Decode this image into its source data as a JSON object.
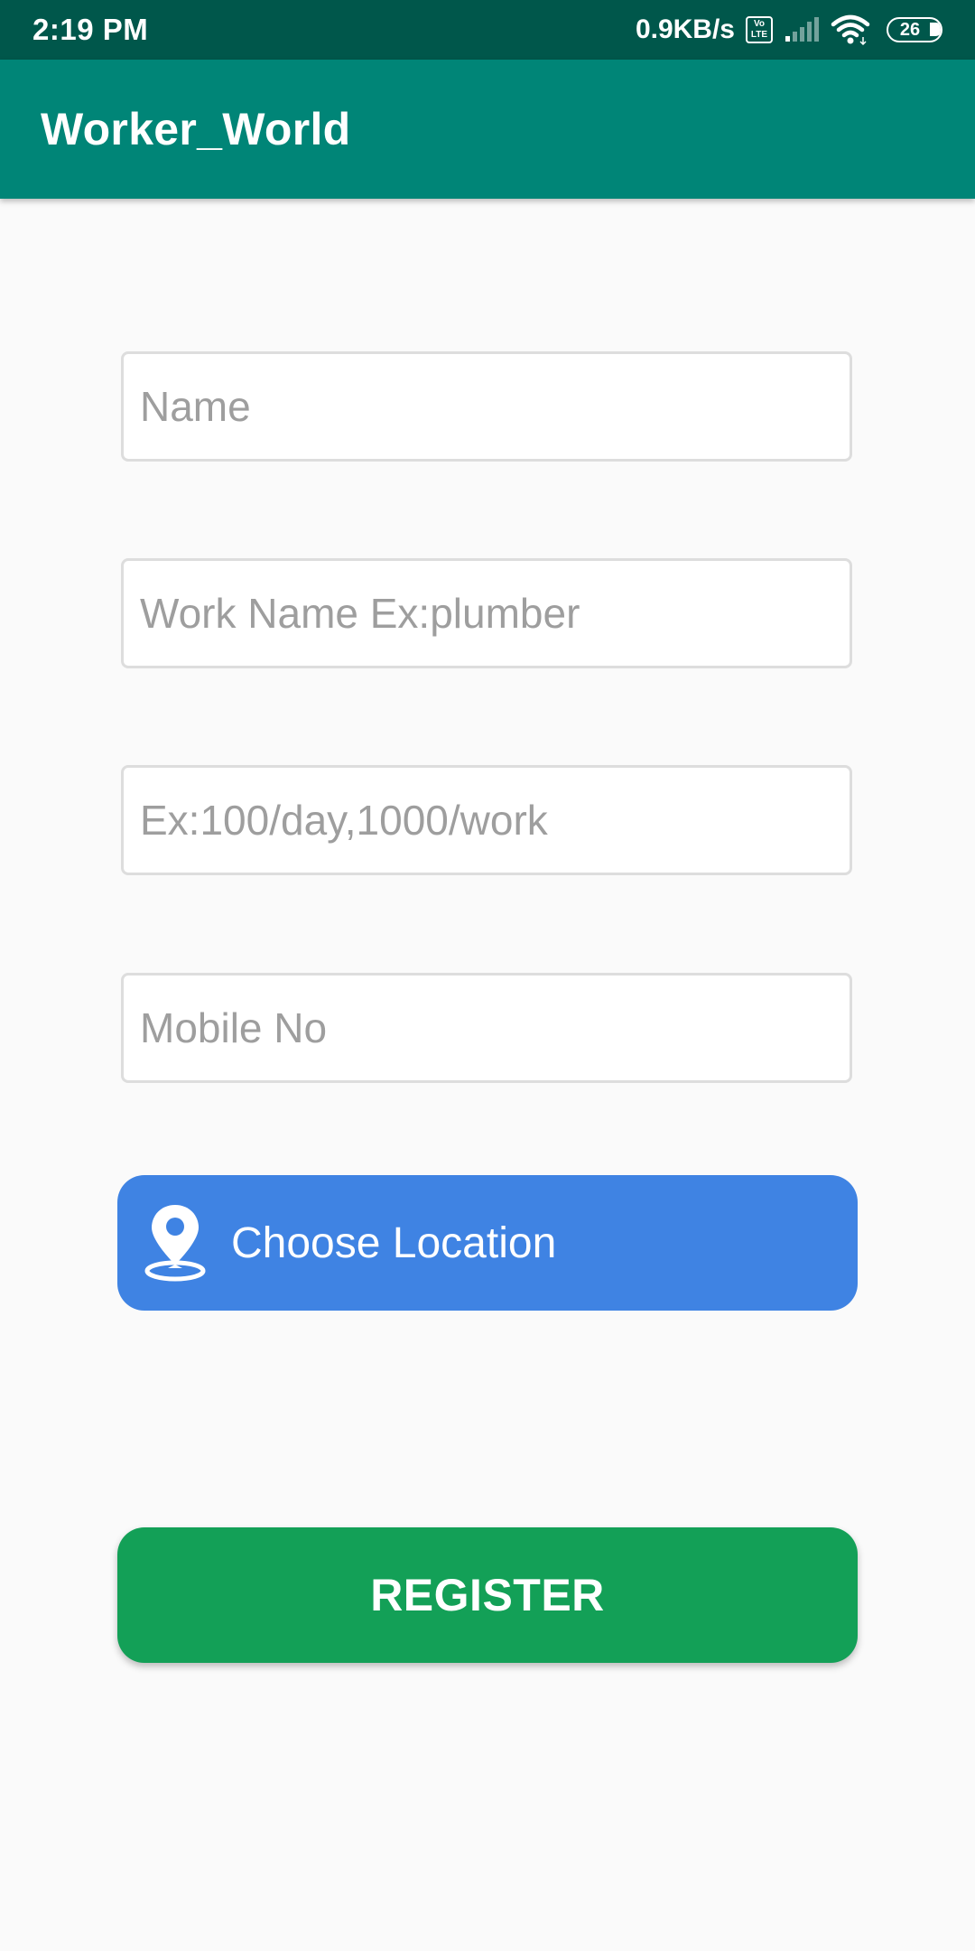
{
  "status_bar": {
    "time": "2:19 PM",
    "network_speed": "0.9KB/s",
    "volte_label": "Vo LTE",
    "battery_level": "26",
    "colors": {
      "background": "#00574b",
      "foreground": "#ffffff"
    }
  },
  "app_bar": {
    "title": "Worker_World",
    "color": "#008577"
  },
  "form": {
    "name": {
      "value": "",
      "placeholder": "Name"
    },
    "work_name": {
      "value": "",
      "placeholder": "Work Name Ex:plumber"
    },
    "rate": {
      "value": "",
      "placeholder": "Ex:100/day,1000/work"
    },
    "mobile": {
      "value": "",
      "placeholder": "Mobile No"
    }
  },
  "location_button": {
    "label": "Choose Location",
    "icon": "location-pin-icon",
    "color": "#3f83e3"
  },
  "register_button": {
    "label": "REGISTER",
    "color": "#13a057"
  }
}
